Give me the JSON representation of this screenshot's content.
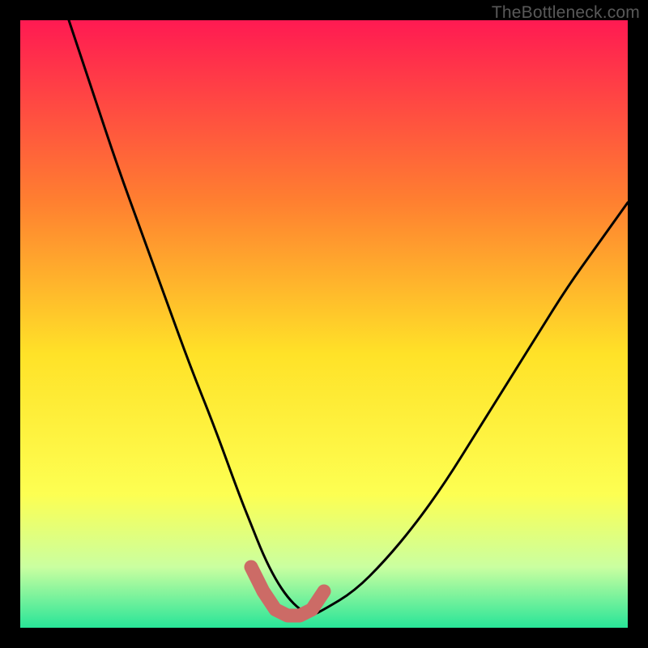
{
  "watermark": "TheBottleneck.com",
  "colors": {
    "frame": "#000000",
    "gradient_top": "#ff1a52",
    "gradient_mid_upper": "#ff8030",
    "gradient_mid": "#ffe228",
    "gradient_mid_lower": "#fdff52",
    "gradient_low": "#caffa0",
    "gradient_bottom": "#28e598",
    "curve": "#000000",
    "marker": "#cc6b66"
  },
  "chart_data": {
    "type": "line",
    "title": "",
    "xlabel": "",
    "ylabel": "",
    "xlim": [
      0,
      100
    ],
    "ylim": [
      0,
      100
    ],
    "grid": false,
    "legend_position": "none",
    "series": [
      {
        "name": "bottleneck-curve",
        "x": [
          8,
          12,
          16,
          20,
          24,
          28,
          32,
          36,
          38,
          40,
          42,
          44,
          46,
          48,
          50,
          55,
          60,
          65,
          70,
          75,
          80,
          85,
          90,
          95,
          100
        ],
        "y": [
          100,
          88,
          76,
          65,
          54,
          43,
          33,
          22,
          17,
          12,
          8,
          5,
          3,
          2,
          3,
          6,
          11,
          17,
          24,
          32,
          40,
          48,
          56,
          63,
          70
        ]
      }
    ],
    "annotations": [
      {
        "name": "optimal-zone-markers",
        "shape": "u-bracket",
        "points_x": [
          38,
          40,
          42,
          44,
          46,
          48,
          50
        ],
        "points_y": [
          10,
          6,
          3,
          2,
          2,
          3,
          6
        ],
        "color": "#cc6b66"
      }
    ],
    "gradient_stops": [
      {
        "offset": 0.0,
        "color": "#ff1a52"
      },
      {
        "offset": 0.3,
        "color": "#ff8030"
      },
      {
        "offset": 0.55,
        "color": "#ffe228"
      },
      {
        "offset": 0.78,
        "color": "#fdff52"
      },
      {
        "offset": 0.9,
        "color": "#caffa0"
      },
      {
        "offset": 1.0,
        "color": "#28e598"
      }
    ]
  }
}
